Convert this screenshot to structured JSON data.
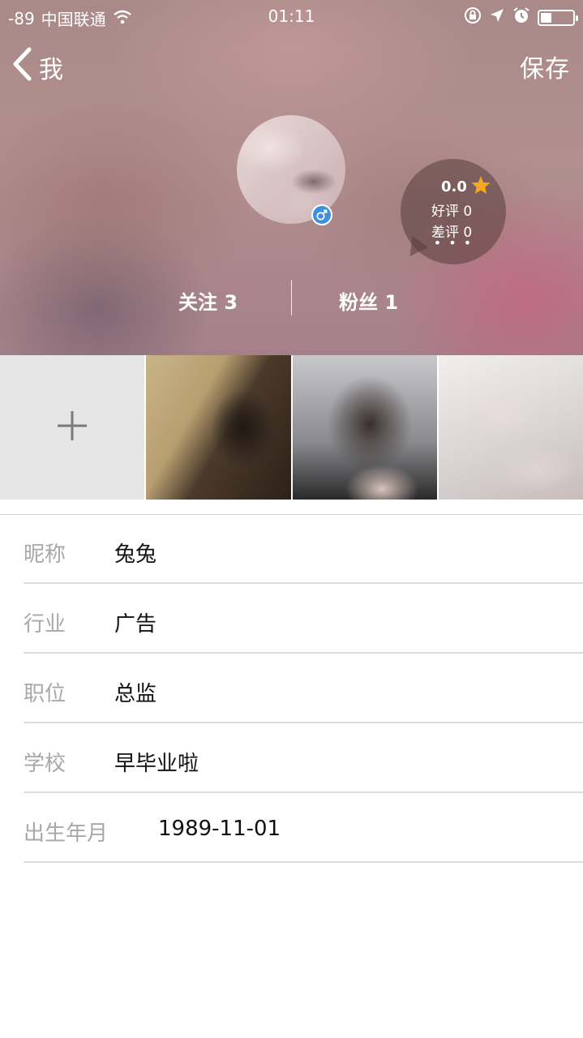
{
  "status_bar": {
    "signal": "-89",
    "carrier": "中国联通",
    "time": "01:11",
    "battery_level": 0.35
  },
  "nav": {
    "back_label": "我",
    "save_label": "保存"
  },
  "profile": {
    "gender_symbol": "♂",
    "rating": {
      "score": "0.0",
      "good": "好评 0",
      "bad": "差评 0",
      "more": "• • •"
    },
    "follow": "关注 3",
    "fans": "粉丝 1"
  },
  "photos": {
    "add_symbol": "+",
    "count": 3
  },
  "fields": [
    {
      "label": "昵称",
      "value": "兔兔"
    },
    {
      "label": "行业",
      "value": "广告"
    },
    {
      "label": "职位",
      "value": "总监"
    },
    {
      "label": "学校",
      "value": "早毕业啦"
    },
    {
      "label": "出生年月",
      "value": "1989-11-01"
    }
  ],
  "colors": {
    "accent_blue": "#3d8fe0",
    "star": "#f5a623",
    "label_gray": "#a8a8a8"
  },
  "icons": [
    "wifi-icon",
    "lock-rotation-icon",
    "location-arrow-icon",
    "alarm-icon",
    "battery-icon",
    "back-chevron-icon",
    "star-icon",
    "male-icon",
    "plus-icon"
  ]
}
